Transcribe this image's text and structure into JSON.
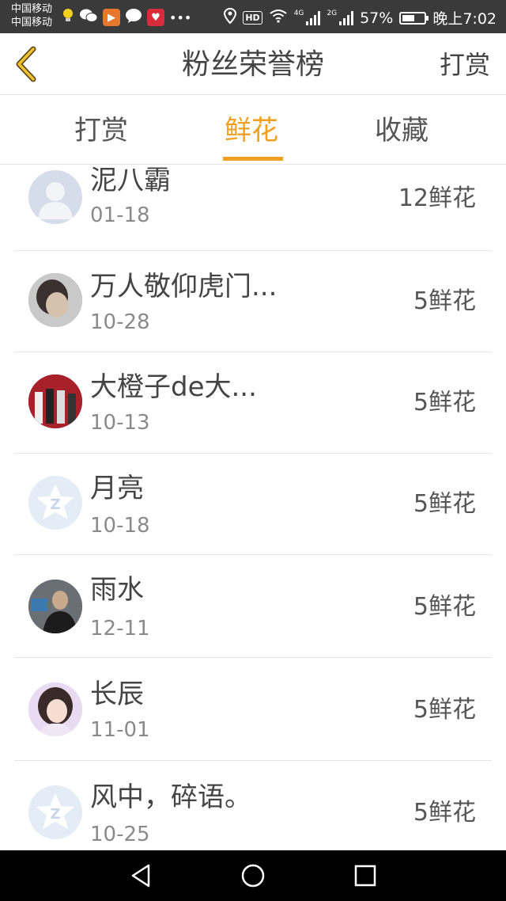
{
  "status_bar": {
    "carrier_1": "中国移动",
    "carrier_2": "中国移动",
    "network_1": "4G",
    "network_2": "2G",
    "battery_percent": "57%",
    "battery_level": 0.57,
    "time": "晚上7:02"
  },
  "header": {
    "title": "粉丝荣誉榜",
    "right_action": "打赏"
  },
  "tabs": [
    {
      "label": "打赏",
      "active": false
    },
    {
      "label": "鲜花",
      "active": true
    },
    {
      "label": "收藏",
      "active": false
    }
  ],
  "list": [
    {
      "name": "泥八霸",
      "date": "01-18",
      "amount": "12鲜花",
      "avatar": "default-person-avatar"
    },
    {
      "name": "万人敬仰虎门...",
      "date": "10-28",
      "amount": "5鲜花",
      "avatar": "photo-avatar"
    },
    {
      "name": "大橙子de大...",
      "date": "10-13",
      "amount": "5鲜花",
      "avatar": "group-photo-avatar"
    },
    {
      "name": "月亮",
      "date": "10-18",
      "amount": "5鲜花",
      "avatar": "qzone-default-avatar"
    },
    {
      "name": "雨水",
      "date": "12-11",
      "amount": "5鲜花",
      "avatar": "photo-avatar"
    },
    {
      "name": "长辰",
      "date": "11-01",
      "amount": "5鲜花",
      "avatar": "illustrated-girl-avatar"
    },
    {
      "name": "风中，碎语。",
      "date": "10-25",
      "amount": "5鲜花",
      "avatar": "qzone-default-avatar"
    }
  ],
  "colors": {
    "accent": "#f0a020",
    "status_bar": "#3a3a3a",
    "text": "#444444",
    "subtext": "#8a8a8a"
  }
}
